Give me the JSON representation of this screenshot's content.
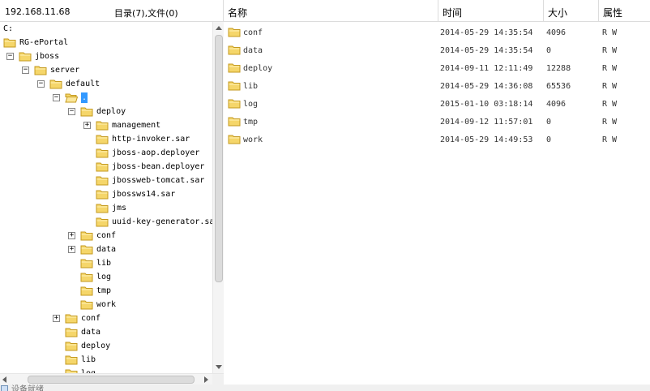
{
  "left_header": {
    "ip": "192.168.11.68",
    "summary": "目录(7),文件(0)"
  },
  "colors": {
    "folder_fill": "#f5d66a",
    "folder_edge": "#c49a1f",
    "selection": "#3399ff"
  },
  "tree": [
    {
      "label": "C:",
      "expander": "",
      "icon": "none"
    },
    {
      "label": "RG-ePortal",
      "expander": "",
      "icon": "folder-icon"
    },
    {
      "label": "jboss",
      "expander": "−",
      "icon": "folder-icon"
    },
    {
      "label": "server",
      "expander": "−",
      "icon": "folder-icon"
    },
    {
      "label": "default",
      "expander": "−",
      "icon": "folder-icon"
    },
    {
      "label": ".",
      "expander": "−",
      "icon": "folder-open-icon",
      "selected": true
    },
    {
      "label": "deploy",
      "expander": "−",
      "icon": "folder-icon"
    },
    {
      "label": "management",
      "expander": "+",
      "icon": "folder-icon"
    },
    {
      "label": "http-invoker.sar",
      "expander": "",
      "icon": "folder-icon"
    },
    {
      "label": "jboss-aop.deployer",
      "expander": "",
      "icon": "folder-icon"
    },
    {
      "label": "jboss-bean.deployer",
      "expander": "",
      "icon": "folder-icon"
    },
    {
      "label": "jbossweb-tomcat.sar",
      "expander": "",
      "icon": "folder-icon"
    },
    {
      "label": "jbossws14.sar",
      "expander": "",
      "icon": "folder-icon"
    },
    {
      "label": "jms",
      "expander": "",
      "icon": "folder-icon"
    },
    {
      "label": "uuid-key-generator.sar",
      "expander": "",
      "icon": "folder-icon"
    },
    {
      "label": "conf",
      "expander": "+",
      "icon": "folder-icon"
    },
    {
      "label": "data",
      "expander": "+",
      "icon": "folder-icon"
    },
    {
      "label": "lib",
      "expander": "",
      "icon": "folder-icon"
    },
    {
      "label": "log",
      "expander": "",
      "icon": "folder-icon"
    },
    {
      "label": "tmp",
      "expander": "",
      "icon": "folder-icon"
    },
    {
      "label": "work",
      "expander": "",
      "icon": "folder-icon"
    },
    {
      "label": "conf",
      "expander": "+",
      "icon": "folder-icon"
    },
    {
      "label": "data",
      "expander": "",
      "icon": "folder-icon"
    },
    {
      "label": "deploy",
      "expander": "",
      "icon": "folder-icon"
    },
    {
      "label": "lib",
      "expander": "",
      "icon": "folder-icon"
    },
    {
      "label": "log",
      "expander": "",
      "icon": "folder-icon"
    }
  ],
  "columns": {
    "name": "名称",
    "time": "时间",
    "size": "大小",
    "attr": "属性"
  },
  "files": [
    {
      "name": "conf",
      "time": "2014-05-29 14:35:54",
      "size": "4096",
      "attr": "R W"
    },
    {
      "name": "data",
      "time": "2014-05-29 14:35:54",
      "size": "0",
      "attr": "R W"
    },
    {
      "name": "deploy",
      "time": "2014-09-11 12:11:49",
      "size": "12288",
      "attr": "R W"
    },
    {
      "name": "lib",
      "time": "2014-05-29 14:36:08",
      "size": "65536",
      "attr": "R W"
    },
    {
      "name": "log",
      "time": "2015-01-10 03:18:14",
      "size": "4096",
      "attr": "R W"
    },
    {
      "name": "tmp",
      "time": "2014-09-12 11:57:01",
      "size": "0",
      "attr": "R W"
    },
    {
      "name": "work",
      "time": "2014-05-29 14:49:53",
      "size": "0",
      "attr": "R W"
    }
  ],
  "status": {
    "text": "设备就绪"
  }
}
